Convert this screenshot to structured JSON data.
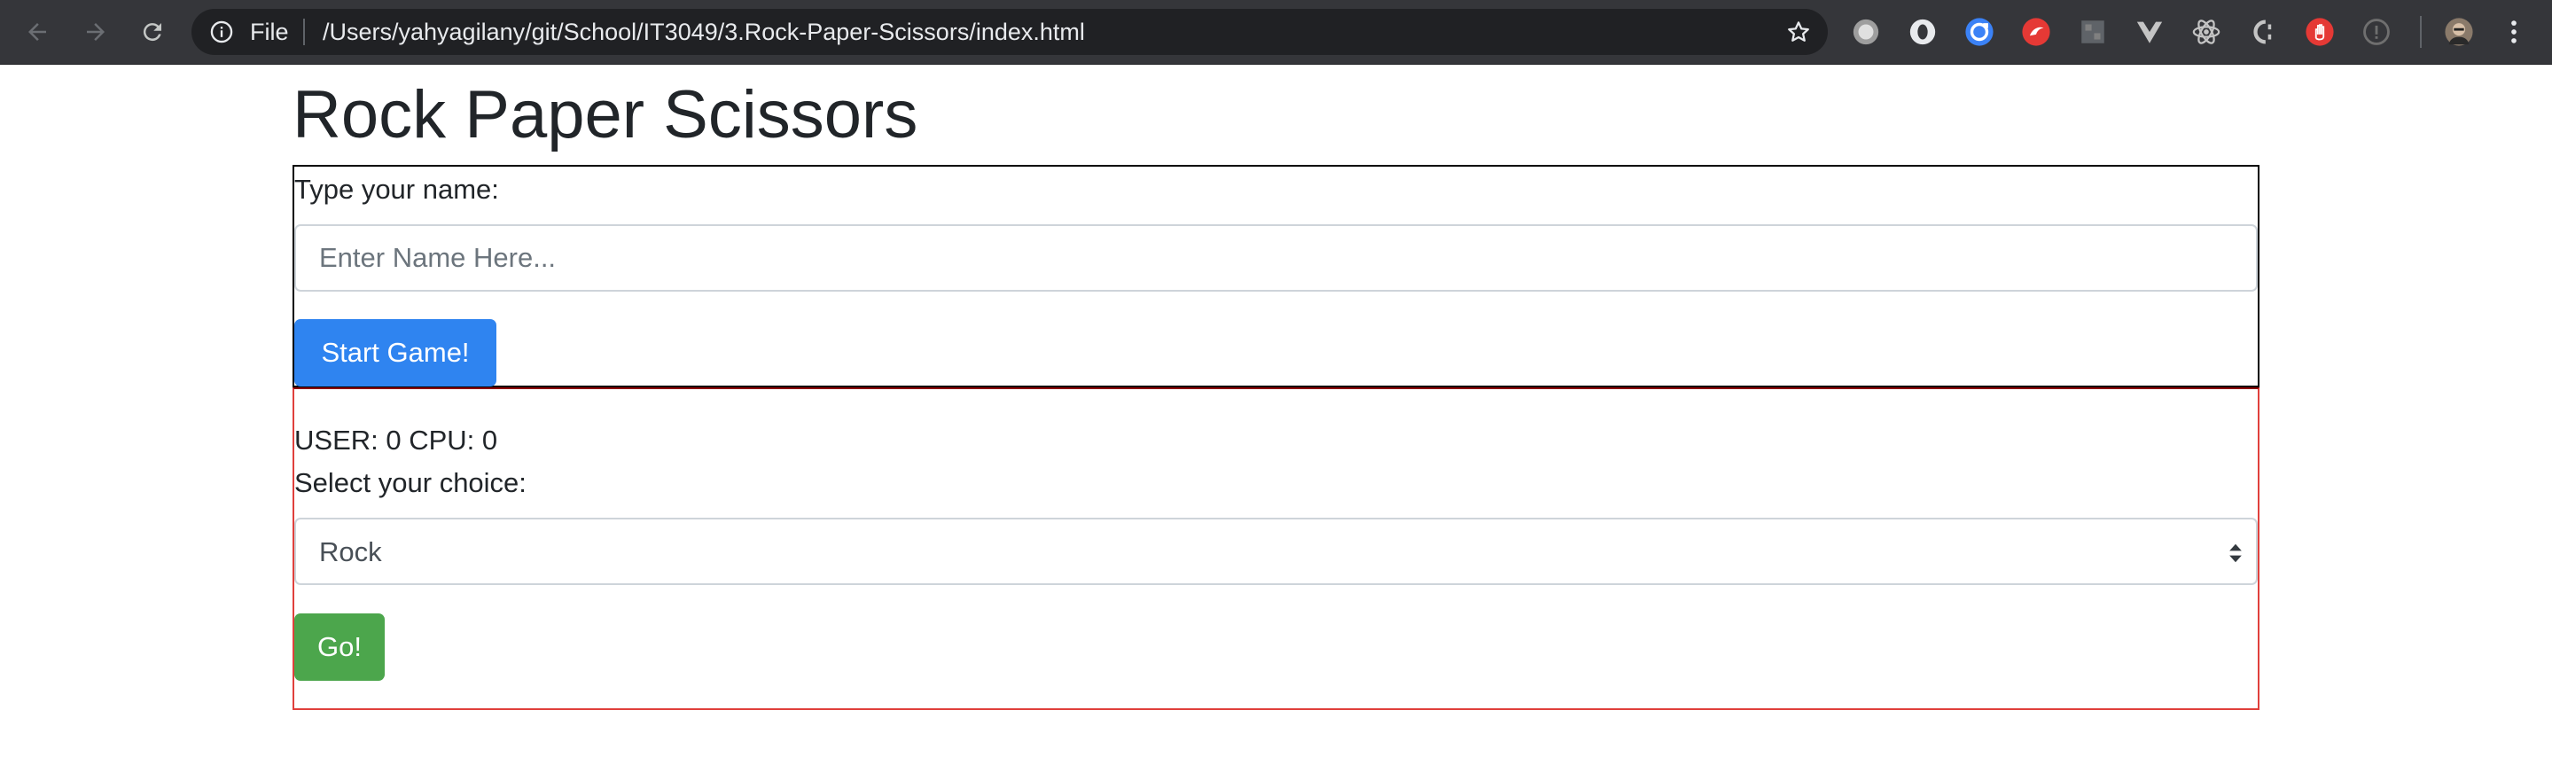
{
  "browser": {
    "url_scheme_label": "File",
    "url": "/Users/yahyagilany/git/School/IT3049/3.Rock-Paper-Scissors/index.html",
    "icons": [
      "back-icon",
      "forward-icon",
      "reload-icon",
      "info-icon",
      "star-icon",
      "more-icon"
    ],
    "extensions": [
      {
        "name": "circle-grey-extension-icon",
        "color": "#c9c9c9"
      },
      {
        "name": "ring-extension-icon",
        "color": "#e8eaed"
      },
      {
        "name": "sync-blue-extension-icon",
        "color": "#3b82f6"
      },
      {
        "name": "red-bird-extension-icon",
        "color": "#e53935"
      },
      {
        "name": "grid-extension-icon",
        "color": "#6f6f6f"
      },
      {
        "name": "vue-extension-icon",
        "color": "#c4c4c4"
      },
      {
        "name": "react-extension-icon",
        "color": "#c4c4c4"
      },
      {
        "name": "c-bracket-extension-icon",
        "color": "#c4c4c4"
      },
      {
        "name": "red-hand-extension-icon",
        "color": "#e53935"
      },
      {
        "name": "info-grey-extension-icon",
        "color": "#6f6f6f"
      }
    ]
  },
  "page": {
    "title": "Rock Paper Scissors",
    "name_form": {
      "label": "Type your name:",
      "placeholder": "Enter Name Here...",
      "start_button": "Start Game!"
    },
    "game": {
      "score_text": "USER: 0 CPU: 0",
      "choice_label": "Select your choice:",
      "selected_choice": "Rock",
      "go_button": "Go!"
    }
  },
  "colors": {
    "primary": "#2f84f0",
    "success": "#4ca64c",
    "game_border": "#e0403c",
    "name_border": "#000000"
  }
}
